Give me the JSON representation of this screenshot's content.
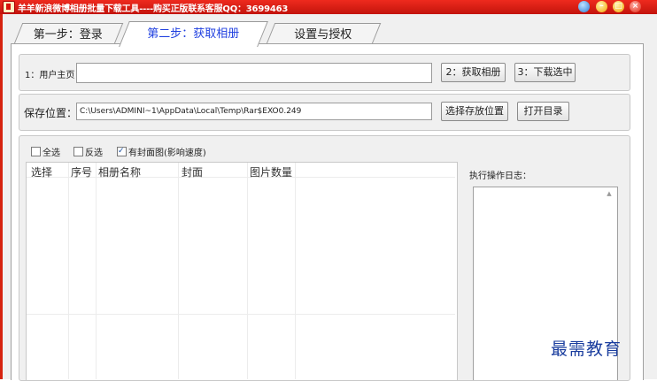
{
  "window": {
    "title": "羊羊新浪微博相册批量下载工具----购买正版联系客服QQ：3699463",
    "controls": [
      "skin-icon",
      "minimize-icon",
      "maximize-icon",
      "close-icon"
    ]
  },
  "tabs": [
    {
      "label": "第一步：登录"
    },
    {
      "label": "第二步：获取相册",
      "active": true
    },
    {
      "label": "设置与授权"
    }
  ],
  "user_row": {
    "label": "1：用户主页：",
    "value": "",
    "get_albums_button": "2：获取相册",
    "download_selected_button": "3：下载选中"
  },
  "save_row": {
    "label": "保存位置：",
    "path": "C:\\Users\\ADMINI~1\\AppData\\Local\\Temp\\Rar$EXO0.249",
    "choose_button": "选择存放位置",
    "open_button": "打开目录"
  },
  "options": {
    "select_all": {
      "label": "全选",
      "checked": false
    },
    "invert": {
      "label": "反选",
      "checked": false
    },
    "with_cover": {
      "label": "有封面图(影响速度)",
      "checked": true
    }
  },
  "table": {
    "columns": [
      "选择",
      "序号",
      "相册名称",
      "封面",
      "图片数量"
    ],
    "rows": []
  },
  "log": {
    "label": "执行操作日志："
  },
  "watermark": "最需教育",
  "colors": {
    "titlebar": "#d6230f",
    "active_tab_text": "#2040e0",
    "watermark": "#1a3d9e"
  }
}
